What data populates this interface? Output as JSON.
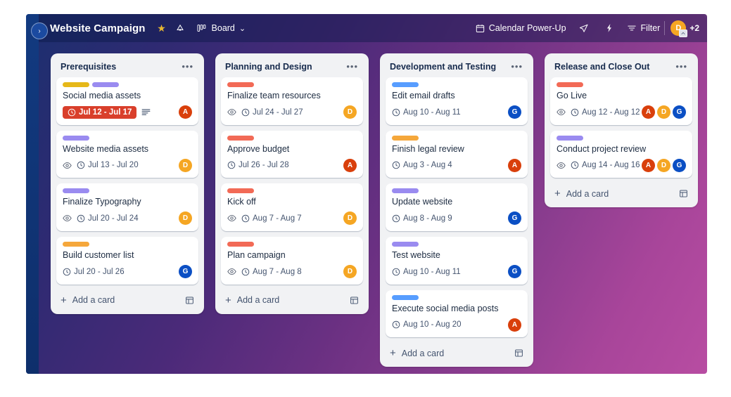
{
  "header": {
    "sidebar_toggle": "›",
    "board_title": "Website Campaign",
    "star_icon": "star-icon",
    "visibility_icon": "workspace-visible-icon",
    "board_view_icon": "board-view-icon",
    "view_label": "Board",
    "view_chevron": "⌄",
    "power_up_label": "Calendar Power-Up",
    "power_up_icon": "calendar-icon",
    "share_icon": "send-icon",
    "automation_icon": "lightning-icon",
    "filter_icon": "filter-icon",
    "filter_label": "Filter",
    "avatar": {
      "initial": "D",
      "color": "#f5a623"
    },
    "extra_members": "+2"
  },
  "colors": {
    "label_yellow": "#e6b819",
    "label_purple": "#9a8bf0",
    "label_orange": "#f5a73b",
    "label_red": "#f26a56",
    "label_blue": "#579dff",
    "avatar_red": "#d93f0b",
    "avatar_orange": "#f5a623",
    "avatar_blue": "#0b4fc4",
    "overdue_red": "#d93f2b",
    "list_bg": "#f1f2f4"
  },
  "add_card_label": "Add a card",
  "lists": [
    {
      "title": "Prerequisites",
      "menu": "•••",
      "cards": [
        {
          "title": "Social media assets",
          "labels": [
            "#e6b819",
            "#9a8bf0"
          ],
          "watching": false,
          "due": "Jul 12 - Jul 17",
          "overdue": true,
          "has_description": true,
          "members": [
            {
              "initial": "A",
              "color": "#d93f0b"
            }
          ]
        },
        {
          "title": "Website media assets",
          "labels": [
            "#9a8bf0"
          ],
          "watching": true,
          "due": "Jul 13 - Jul 20",
          "overdue": false,
          "has_description": false,
          "members": [
            {
              "initial": "D",
              "color": "#f5a623"
            }
          ]
        },
        {
          "title": "Finalize Typography",
          "labels": [
            "#9a8bf0"
          ],
          "watching": true,
          "due": "Jul 20 - Jul 24",
          "overdue": false,
          "has_description": false,
          "members": [
            {
              "initial": "D",
              "color": "#f5a623"
            }
          ]
        },
        {
          "title": "Build customer list",
          "labels": [
            "#f5a73b"
          ],
          "watching": false,
          "due": "Jul 20 - Jul 26",
          "overdue": false,
          "has_description": false,
          "members": [
            {
              "initial": "G",
              "color": "#0b4fc4"
            }
          ]
        }
      ]
    },
    {
      "title": "Planning and Design",
      "menu": "•••",
      "cards": [
        {
          "title": "Finalize team resources",
          "labels": [
            "#f26a56"
          ],
          "watching": true,
          "due": "Jul 24 - Jul 27",
          "overdue": false,
          "has_description": false,
          "members": [
            {
              "initial": "D",
              "color": "#f5a623"
            }
          ]
        },
        {
          "title": "Approve budget",
          "labels": [
            "#f26a56"
          ],
          "watching": false,
          "due": "Jul 26 - Jul 28",
          "overdue": false,
          "has_description": false,
          "members": [
            {
              "initial": "A",
              "color": "#d93f0b"
            }
          ]
        },
        {
          "title": "Kick off",
          "labels": [
            "#f26a56"
          ],
          "watching": true,
          "due": "Aug 7 - Aug 7",
          "overdue": false,
          "has_description": false,
          "members": [
            {
              "initial": "D",
              "color": "#f5a623"
            }
          ]
        },
        {
          "title": "Plan campaign",
          "labels": [
            "#f26a56"
          ],
          "watching": true,
          "due": "Aug 7 - Aug 8",
          "overdue": false,
          "has_description": false,
          "members": [
            {
              "initial": "D",
              "color": "#f5a623"
            }
          ]
        }
      ]
    },
    {
      "title": "Development and Testing",
      "menu": "•••",
      "cards": [
        {
          "title": "Edit email drafts",
          "labels": [
            "#579dff"
          ],
          "watching": false,
          "due": "Aug 10 - Aug 11",
          "overdue": false,
          "has_description": false,
          "members": [
            {
              "initial": "G",
              "color": "#0b4fc4"
            }
          ]
        },
        {
          "title": "Finish legal review",
          "labels": [
            "#f5a73b"
          ],
          "watching": false,
          "due": "Aug 3 - Aug 4",
          "overdue": false,
          "has_description": false,
          "members": [
            {
              "initial": "A",
              "color": "#d93f0b"
            }
          ]
        },
        {
          "title": "Update website",
          "labels": [
            "#9a8bf0"
          ],
          "watching": false,
          "due": "Aug 8 - Aug 9",
          "overdue": false,
          "has_description": false,
          "members": [
            {
              "initial": "G",
              "color": "#0b4fc4"
            }
          ]
        },
        {
          "title": "Test website",
          "labels": [
            "#9a8bf0"
          ],
          "watching": false,
          "due": "Aug 10 - Aug 11",
          "overdue": false,
          "has_description": false,
          "members": [
            {
              "initial": "G",
              "color": "#0b4fc4"
            }
          ]
        },
        {
          "title": "Execute social media posts",
          "labels": [
            "#579dff"
          ],
          "watching": false,
          "due": "Aug 10 - Aug 20",
          "overdue": false,
          "has_description": false,
          "members": [
            {
              "initial": "A",
              "color": "#d93f0b"
            }
          ]
        }
      ]
    },
    {
      "title": "Release and Close Out",
      "menu": "•••",
      "cards": [
        {
          "title": "Go Live",
          "labels": [
            "#f26a56"
          ],
          "watching": true,
          "due": "Aug 12 - Aug 12",
          "overdue": false,
          "has_description": false,
          "members": [
            {
              "initial": "A",
              "color": "#d93f0b"
            },
            {
              "initial": "D",
              "color": "#f5a623"
            },
            {
              "initial": "G",
              "color": "#0b4fc4"
            }
          ]
        },
        {
          "title": "Conduct project review",
          "labels": [
            "#9a8bf0"
          ],
          "watching": true,
          "due": "Aug 14 - Aug 16",
          "overdue": false,
          "has_description": false,
          "members": [
            {
              "initial": "A",
              "color": "#d93f0b"
            },
            {
              "initial": "D",
              "color": "#f5a623"
            },
            {
              "initial": "G",
              "color": "#0b4fc4"
            }
          ]
        }
      ]
    }
  ]
}
